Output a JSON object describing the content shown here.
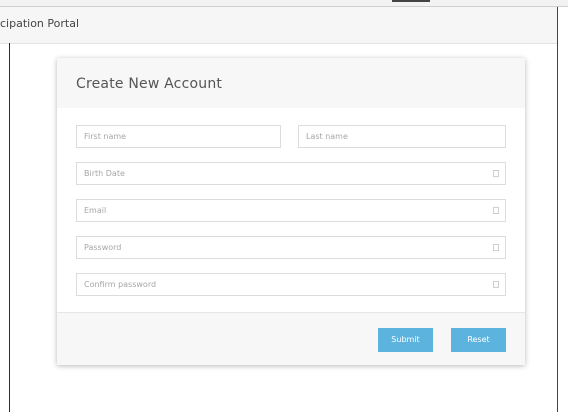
{
  "header": {
    "title": "cipation Portal"
  },
  "form": {
    "title": "Create New Account",
    "fields": {
      "first_name": {
        "placeholder": "First name"
      },
      "last_name": {
        "placeholder": "Last name"
      },
      "birth_date": {
        "placeholder": "Birth Date"
      },
      "email": {
        "placeholder": "Email"
      },
      "password": {
        "placeholder": "Password"
      },
      "confirm_password": {
        "placeholder": "Confirm password"
      }
    },
    "buttons": {
      "submit": "Submit",
      "reset": "Reset"
    }
  },
  "colors": {
    "button": "#5cb3de",
    "panel": "#f7f7f7",
    "field_border": "#dcdcdc"
  }
}
